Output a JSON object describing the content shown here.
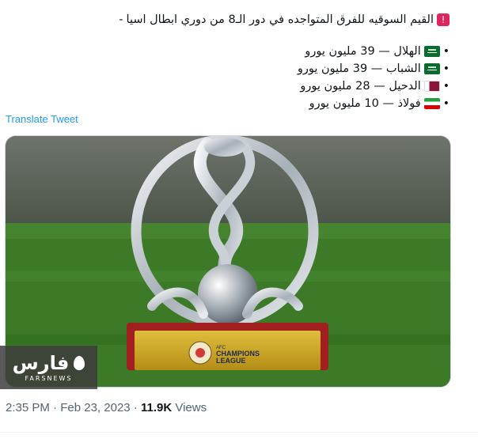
{
  "tweet": {
    "headline": "القيم السوقيه للفرق المتواجده في دور الـ8 من دوري ابطال اسيا",
    "lead_dash": "-",
    "teams": [
      {
        "flag": "saudi-flag",
        "text": "الهلال — 39 مليون يورو"
      },
      {
        "flag": "saudi-flag",
        "text": "الشباب — 39 مليون يورو"
      },
      {
        "flag": "qatar-flag",
        "text": "الدحيل — 28 مليون يورو"
      },
      {
        "flag": "iran-flag",
        "text": "فولاذ — 10 مليون يورو"
      }
    ],
    "translate_label": "Translate Tweet"
  },
  "media": {
    "trophy_badge_line1": "AFC",
    "trophy_badge_line2": "CHAMPIONS",
    "trophy_badge_line3": "LEAGUE",
    "watermark_main": "فارس",
    "watermark_sub": "FARSNEWS"
  },
  "meta": {
    "time": "2:35 PM",
    "sep": "·",
    "date": "Feb 23, 2023",
    "views_count": "11.9K",
    "views_label": "Views"
  },
  "colors": {
    "link": "#1d9bf0",
    "muted": "#536471",
    "grass": "#3d7a26",
    "trophy_base": "#c8a227"
  }
}
